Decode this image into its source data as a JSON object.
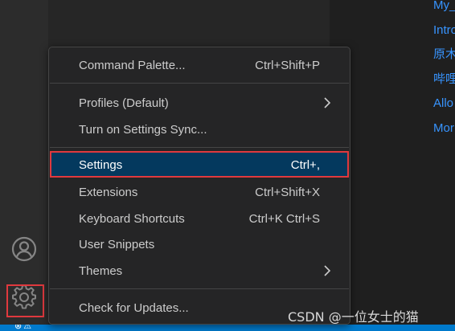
{
  "editor": {
    "links": [
      "My_",
      "Intro",
      "原木",
      "哔哩",
      "Allo",
      "Mor"
    ]
  },
  "activity_bar": {
    "account_icon": "account-icon",
    "manage_icon": "gear-icon"
  },
  "menu": {
    "groups": [
      [
        {
          "label": "Command Palette...",
          "shortcut": "Ctrl+Shift+P"
        }
      ],
      [
        {
          "label": "Profiles (Default)",
          "submenu": true
        },
        {
          "label": "Turn on Settings Sync..."
        }
      ],
      [
        {
          "label": "Settings",
          "shortcut": "Ctrl+,",
          "selected": true
        },
        {
          "label": "Extensions",
          "shortcut": "Ctrl+Shift+X"
        },
        {
          "label": "Keyboard Shortcuts",
          "shortcut": "Ctrl+K Ctrl+S"
        },
        {
          "label": "User Snippets"
        },
        {
          "label": "Themes",
          "submenu": true
        }
      ],
      [
        {
          "label": "Check for Updates..."
        }
      ]
    ]
  },
  "watermark": "CSDN @一位女士的猫",
  "colors": {
    "accent_highlight": "#e0393e",
    "selection_bg": "#04395e",
    "link": "#3794ff",
    "status_bar": "#007acc"
  }
}
